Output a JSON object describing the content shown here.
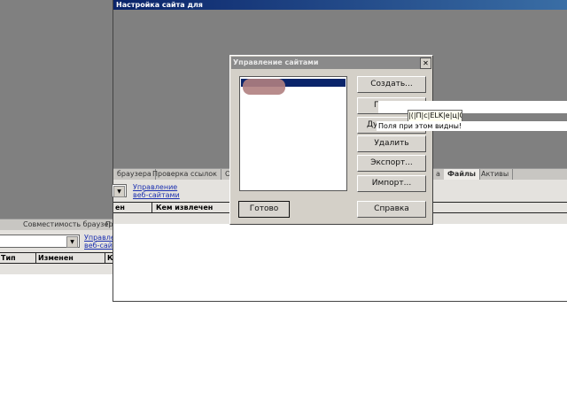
{
  "back_window": {
    "tabs": [
      "Совместимость браузера",
      "П"
    ],
    "link": [
      "Управле",
      "веб-сай"
    ],
    "columns": [
      "Тип",
      "Изменен",
      "К"
    ]
  },
  "front_window": {
    "title": "Настройка сайта для",
    "tabs": [
      "браузера",
      "Проверка ссылок",
      "О",
      "а",
      "Файлы",
      "Активы"
    ],
    "link": [
      "Управление",
      "веб-сайтами"
    ],
    "columns": [
      "ен",
      "Кем извлечен"
    ]
  },
  "dialog": {
    "title": "Управление сайтами",
    "close": "✕",
    "buttons": {
      "create": "Создать...",
      "edit": "П",
      "duplicate": "Ду",
      "delete": "Удалить",
      "export": "Экспорт...",
      "import": "Импорт...",
      "done": "Готово",
      "help": "Справка"
    }
  },
  "overlay": {
    "garbled": "|(|П|c|ELK|e|ц|G",
    "message": "Поля при этом видны!"
  }
}
